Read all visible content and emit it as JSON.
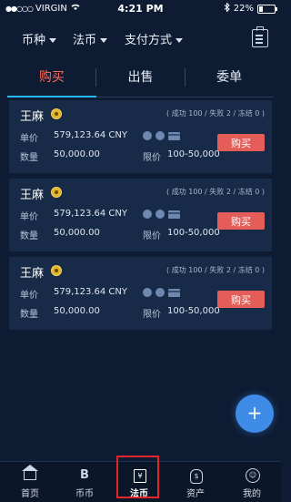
{
  "status_bar": {
    "carrier": "VIRGIN",
    "signal_dots": "●●○○○",
    "time": "4:21 PM",
    "battery": "22%"
  },
  "filters": {
    "coin": "币种",
    "fiat": "法币",
    "payment": "支付方式"
  },
  "tabs": [
    {
      "label": "购买"
    },
    {
      "label": "出售"
    },
    {
      "label": "委单"
    }
  ],
  "orders": [
    {
      "name": "王麻",
      "stats": "( 成功 100 / 失败 2 / 冻结 0 )",
      "price_label": "单价",
      "price": "579,123.64 CNY",
      "qty_label": "数量",
      "qty": "50,000.00",
      "limit_label": "限价",
      "limit": "100-50,000",
      "buy_label": "购买"
    },
    {
      "name": "王麻",
      "stats": "( 成功 100 / 失败 2 / 冻结 0 )",
      "price_label": "单价",
      "price": "579,123.64 CNY",
      "qty_label": "数量",
      "qty": "50,000.00",
      "limit_label": "限价",
      "limit": "100-50,000",
      "buy_label": "购买"
    },
    {
      "name": "王麻",
      "stats": "( 成功 100 / 失败 2 / 冻结 0 )",
      "price_label": "单价",
      "price": "579,123.64 CNY",
      "qty_label": "数量",
      "qty": "50,000.00",
      "limit_label": "限价",
      "limit": "100-50,000",
      "buy_label": "购买"
    }
  ],
  "fab": {
    "label": "+"
  },
  "nav": [
    {
      "label": "首页",
      "icon": "home-icon"
    },
    {
      "label": "币币",
      "icon": "bitcoin-icon",
      "glyph": "B"
    },
    {
      "label": "法币",
      "icon": "fiat-icon",
      "glyph": "¥"
    },
    {
      "label": "资产",
      "icon": "wallet-icon",
      "glyph": "$"
    },
    {
      "label": "我的",
      "icon": "user-icon",
      "glyph": "☺"
    }
  ],
  "colors": {
    "background": "#0e1c33",
    "card": "#172a47",
    "accent_tab": "#ff6b5a",
    "buy_button": "#e45d58",
    "fab": "#3e8ce8",
    "highlight_box": "#e3262a"
  }
}
